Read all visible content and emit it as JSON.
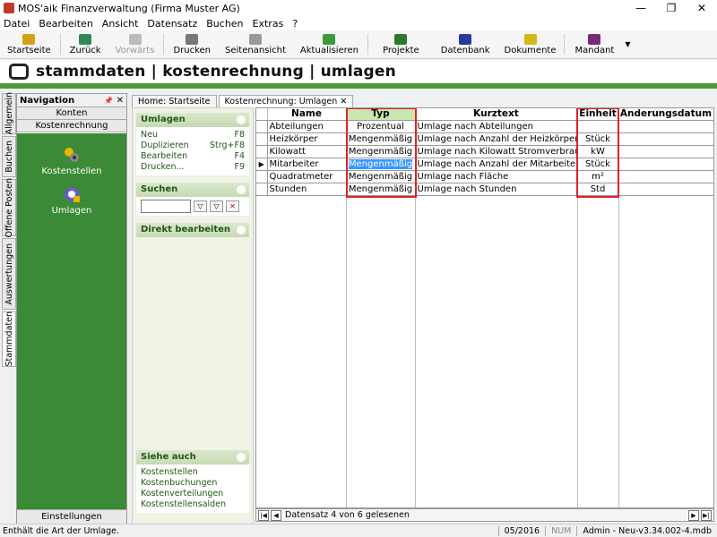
{
  "window": {
    "title": "MOS'aik Finanzverwaltung (Firma Muster AG)",
    "minimize": "—",
    "restore": "❐",
    "close": "✕"
  },
  "menu": [
    "Datei",
    "Bearbeiten",
    "Ansicht",
    "Datensatz",
    "Buchen",
    "Extras",
    "?"
  ],
  "toolbar": {
    "startseite": "Startseite",
    "zurueck": "Zurück",
    "vorwaerts": "Vorwärts",
    "drucken": "Drucken",
    "seitenansicht": "Seitenansicht",
    "aktualisieren": "Aktualisieren",
    "projekte": "Projekte",
    "datenbank": "Datenbank",
    "dokumente": "Dokumente",
    "mandant": "Mandant",
    "dropdown": "▼"
  },
  "banner": {
    "text": "stammdaten | kostenrechnung | umlagen"
  },
  "vtabs": [
    "Allgemein",
    "Buchen",
    "Offene Posten",
    "Auswertungen",
    "Stammdaten"
  ],
  "navigation": {
    "title": "Navigation",
    "pin": "📌",
    "close": "✕",
    "buttons": [
      "Konten",
      "Kostenrechnung"
    ],
    "items": [
      "Kostenstellen",
      "Umlagen"
    ],
    "footer": "Einstellungen"
  },
  "doc_tabs": [
    {
      "label": "Home: Startseite"
    },
    {
      "label": "Kostenrechnung: Umlagen",
      "close": "✕"
    }
  ],
  "actions": {
    "umlagen": {
      "title": "Umlagen",
      "items": [
        {
          "label": "Neu",
          "key": "F8"
        },
        {
          "label": "Duplizieren",
          "key": "Strg+F8"
        },
        {
          "label": "Bearbeiten",
          "key": "F4"
        },
        {
          "label": "Drucken...",
          "key": "F9"
        }
      ]
    },
    "suchen": {
      "title": "Suchen"
    },
    "direkt": {
      "title": "Direkt bearbeiten"
    },
    "siehe": {
      "title": "Siehe auch",
      "links": [
        "Kostenstellen",
        "Kostenbuchungen",
        "Kostenverteilungen",
        "Kostenstellensalden"
      ]
    }
  },
  "grid": {
    "columns": [
      "Name",
      "Typ",
      "Kurztext",
      "Einheit",
      "Änderungsdatum"
    ],
    "rows": [
      {
        "name": "Abteilungen",
        "typ": "Prozentual",
        "kurztext": "Umlage nach Abteilungen",
        "einheit": "",
        "datum": ""
      },
      {
        "name": "Heizkörper",
        "typ": "Mengenmäßig",
        "kurztext": "Umlage nach Anzahl der Heizkörper",
        "einheit": "Stück",
        "datum": ""
      },
      {
        "name": "Kilowatt",
        "typ": "Mengenmäßig",
        "kurztext": "Umlage nach Kilowatt Stromverbrauch",
        "einheit": "kW",
        "datum": ""
      },
      {
        "name": "Mitarbeiter",
        "typ": "Mengenmäßig",
        "kurztext": "Umlage nach Anzahl der Mitarbeiter",
        "einheit": "Stück",
        "datum": ""
      },
      {
        "name": "Quadratmeter",
        "typ": "Mengenmäßig",
        "kurztext": "Umlage nach Fläche",
        "einheit": "m²",
        "datum": ""
      },
      {
        "name": "Stunden",
        "typ": "Mengenmäßig",
        "kurztext": "Umlage nach Stunden",
        "einheit": "Std",
        "datum": ""
      }
    ],
    "current_row_marker": "▶"
  },
  "record_bar": {
    "text": "Datensatz 4 von 6 gelesenen",
    "first": "|◀",
    "prev": "◀",
    "next": "▶",
    "last": "▶|"
  },
  "status": {
    "message": "Enthält die Art der Umlage.",
    "period": "05/2016",
    "num": "NUM",
    "db": "Admin - Neu-v3.34.002-4.mdb"
  },
  "colors": {
    "accent_green": "#4a9a3a",
    "nav_green": "#3b8a35",
    "highlight_red": "#e0202a",
    "selection_blue": "#3399ff"
  }
}
